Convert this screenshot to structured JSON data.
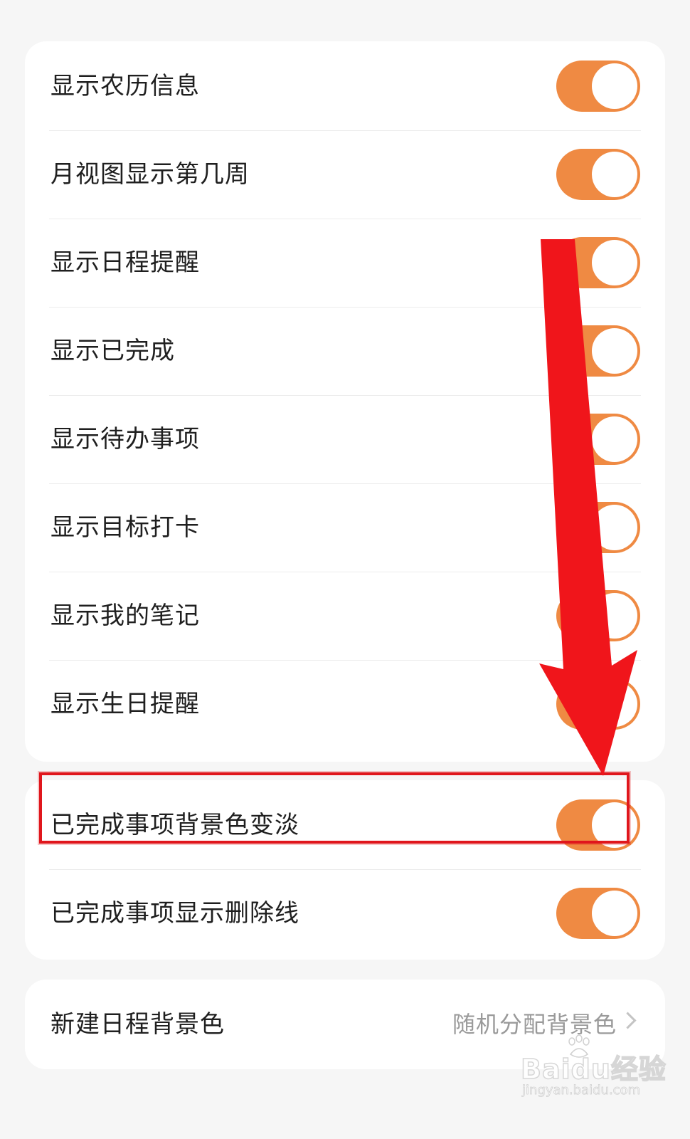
{
  "colors": {
    "accent": "#ef8a43",
    "background": "#f6f6f6",
    "card": "#ffffff",
    "annotation": "#e0161c"
  },
  "group1": {
    "items": [
      {
        "label": "显示农历信息",
        "on": true
      },
      {
        "label": "月视图显示第几周",
        "on": true
      },
      {
        "label": "显示日程提醒",
        "on": true
      },
      {
        "label": "显示已完成",
        "on": true
      },
      {
        "label": "显示待办事项",
        "on": true
      },
      {
        "label": "显示目标打卡",
        "on": true
      },
      {
        "label": "显示我的笔记",
        "on": true
      },
      {
        "label": "显示生日提醒",
        "on": true
      }
    ]
  },
  "group2": {
    "items": [
      {
        "label": "已完成事项背景色变淡",
        "on": true
      },
      {
        "label": "已完成事项显示删除线",
        "on": true
      }
    ]
  },
  "group3": {
    "item": {
      "label": "新建日程背景色",
      "value": "随机分配背景色",
      "icon": "chevron-right-icon"
    }
  },
  "watermark": {
    "main": "Baidu经验",
    "sub": "jingyan.baidu.com"
  }
}
